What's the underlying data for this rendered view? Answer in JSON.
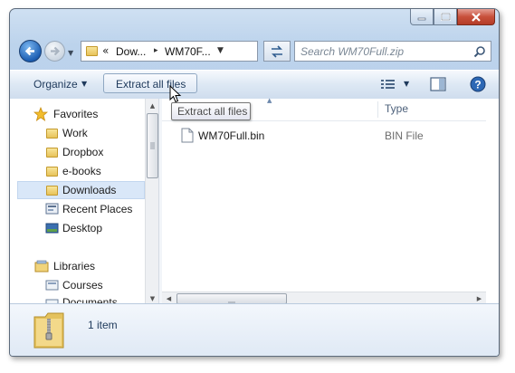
{
  "address": {
    "overflow": "«",
    "crumbs": [
      "Dow...",
      "WM70F..."
    ],
    "separator": "▸"
  },
  "search": {
    "placeholder": "Search WM70Full.zip"
  },
  "toolbar": {
    "organize": "Organize",
    "extract": "Extract all files",
    "tooltip": "Extract all files"
  },
  "nav": {
    "favorites_header": "Favorites",
    "favorites": [
      "Work",
      "Dropbox",
      "e-books",
      "Downloads",
      "Recent Places",
      "Desktop"
    ],
    "selected": "Downloads",
    "libraries_header": "Libraries",
    "libraries": [
      "Courses",
      "Documents"
    ]
  },
  "columns": {
    "type": "Type"
  },
  "files": [
    {
      "name": "WM70Full.bin",
      "type": "BIN File"
    }
  ],
  "details": {
    "count": "1 item"
  },
  "colors": {
    "accent": "#1d5fb3",
    "selection": "#d9e7f8",
    "link_text": "#1e395b"
  }
}
